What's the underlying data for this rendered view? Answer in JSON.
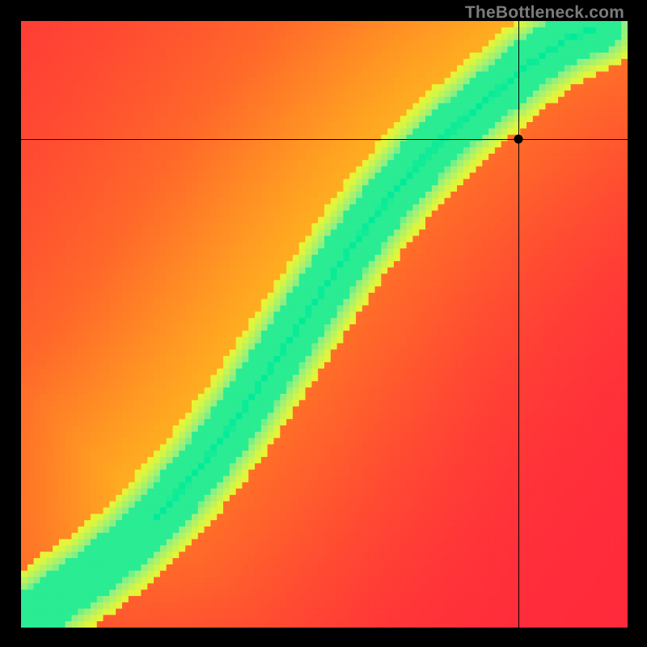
{
  "watermark": "TheBottleneck.com",
  "chart_data": {
    "type": "heatmap",
    "title": "",
    "xlabel": "",
    "ylabel": "",
    "xlim": [
      0,
      100
    ],
    "ylim": [
      0,
      100
    ],
    "grid": false,
    "legend": false,
    "colormap_stops": [
      {
        "t": 0.0,
        "color": "#ff2a3c"
      },
      {
        "t": 0.3,
        "color": "#ff6a2a"
      },
      {
        "t": 0.55,
        "color": "#ffb81f"
      },
      {
        "t": 0.75,
        "color": "#ffe817"
      },
      {
        "t": 0.88,
        "color": "#e4f63a"
      },
      {
        "t": 0.95,
        "color": "#8ff084"
      },
      {
        "t": 1.0,
        "color": "#00eb9a"
      }
    ],
    "ridge": {
      "description": "Curved optimal band (green) through field; value is highest along this curve and falls off with distance.",
      "points_xy": [
        [
          2,
          2
        ],
        [
          6,
          5
        ],
        [
          12,
          9
        ],
        [
          18,
          14
        ],
        [
          24,
          20
        ],
        [
          30,
          27
        ],
        [
          36,
          35
        ],
        [
          42,
          44
        ],
        [
          48,
          53
        ],
        [
          54,
          62
        ],
        [
          60,
          70
        ],
        [
          66,
          77
        ],
        [
          72,
          83
        ],
        [
          78,
          88
        ],
        [
          84,
          93
        ],
        [
          90,
          97
        ],
        [
          95,
          99
        ]
      ],
      "band_half_width_pct": 4.5
    },
    "crosshair": {
      "x": 82.0,
      "y": 80.5
    },
    "marker": {
      "x": 82.0,
      "y": 80.5
    },
    "grid_resolution": 96
  }
}
